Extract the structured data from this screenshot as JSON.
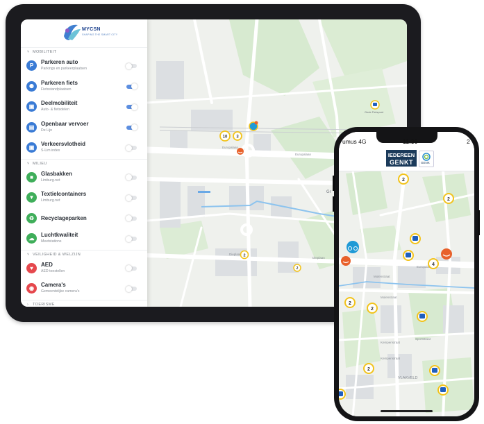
{
  "colors": {
    "accent": "#5c8ee0",
    "marker_yellow": "#f2c31b",
    "marker_orange": "#e8612b",
    "marker_blue": "#1f5fbf",
    "frame": "#1b1b1f"
  },
  "tablet": {
    "brand": {
      "name": "MYCSN",
      "tagline": "SHAPING THE SMART CITY"
    },
    "sections": [
      {
        "title": "MOBILITEIT",
        "layers": [
          {
            "title": "Parkeren auto",
            "subtitle": "Parkings en parkeerplaatsen",
            "icon": "parking-icon",
            "color": "#3a7bd5",
            "enabled": false
          },
          {
            "title": "Parkeren fiets",
            "subtitle": "Fietsstandplaatsen",
            "icon": "bicycle-icon",
            "color": "#3a7bd5",
            "enabled": true
          },
          {
            "title": "Deelmobiliteit",
            "subtitle": "Auto- & fietsdelen",
            "icon": "car-icon",
            "color": "#3a7bd5",
            "enabled": true
          },
          {
            "title": "Openbaar vervoer",
            "subtitle": "De Lijn",
            "icon": "bus-icon",
            "color": "#3a7bd5",
            "enabled": true
          },
          {
            "title": "Verkeersvlotheid",
            "subtitle": "S-Lim index",
            "icon": "car-speed-icon",
            "color": "#3a7bd5",
            "enabled": false
          }
        ]
      },
      {
        "title": "MILIEU",
        "layers": [
          {
            "title": "Glasbakken",
            "subtitle": "Limburg.net",
            "icon": "glass-container-icon",
            "color": "#3fae5a",
            "enabled": false
          },
          {
            "title": "Textielcontainers",
            "subtitle": "Limburg.net",
            "icon": "shirt-icon",
            "color": "#3fae5a",
            "enabled": false
          },
          {
            "title": "Recyclageparken",
            "subtitle": "",
            "icon": "recycle-icon",
            "color": "#3fae5a",
            "enabled": false
          },
          {
            "title": "Luchtkwaliteit",
            "subtitle": "Meetstations",
            "icon": "air-quality-icon",
            "color": "#3fae5a",
            "enabled": false
          }
        ]
      },
      {
        "title": "VEILIGHEID & WELZIJN",
        "layers": [
          {
            "title": "AED",
            "subtitle": "AED toestellen",
            "icon": "heart-icon",
            "color": "#e5484d",
            "enabled": false
          },
          {
            "title": "Camera's",
            "subtitle": "Gemeentelijke camera's",
            "icon": "camera-icon",
            "color": "#e5484d",
            "enabled": false
          }
        ]
      },
      {
        "title": "TOERISME",
        "layers": []
      }
    ],
    "map": {
      "streets": [
        "Europalaan",
        "Europalaan",
        "Dieplaan",
        "Dieplaan"
      ],
      "poi": "Genk Fietspunt",
      "partial_label": "Gr",
      "clusters": [
        "10",
        "3",
        "2",
        "2"
      ]
    }
  },
  "phone": {
    "status": {
      "carrier": "umus 4G",
      "time": "11:36",
      "battery": "2"
    },
    "header": {
      "logo_line1": "IEDEREEN",
      "logo_line2": "GENKT",
      "city_logo": "GENK"
    },
    "map": {
      "streets": [
        "Europalaan",
        "Molenstraat",
        "Molenstraat",
        "Kempenstraat",
        "Kempenstraat",
        "Sportstraat"
      ],
      "area": "VLAKVELD",
      "clusters": [
        "2",
        "2",
        "4",
        "2",
        "2",
        "2"
      ]
    }
  }
}
